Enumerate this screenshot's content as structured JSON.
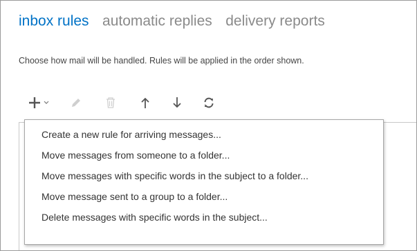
{
  "tabs": [
    {
      "label": "inbox rules",
      "active": true
    },
    {
      "label": "automatic replies",
      "active": false
    },
    {
      "label": "delivery reports",
      "active": false
    }
  ],
  "description": "Choose how mail will be handled. Rules will be applied in the order shown.",
  "toolbar": {
    "buttons": [
      {
        "icon": "plus-icon",
        "enabled": true
      },
      {
        "icon": "chevron-down-icon",
        "enabled": true
      },
      {
        "icon": "pencil-icon",
        "enabled": false
      },
      {
        "icon": "trash-icon",
        "enabled": false
      },
      {
        "icon": "arrow-up-icon",
        "enabled": true
      },
      {
        "icon": "arrow-down-icon",
        "enabled": true
      },
      {
        "icon": "refresh-icon",
        "enabled": true
      }
    ]
  },
  "menu": {
    "items": [
      {
        "label": "Create a new rule for arriving messages..."
      },
      {
        "label": "Move messages from someone to a folder..."
      },
      {
        "label": "Move messages with specific words in the subject to a folder..."
      },
      {
        "label": "Move message sent to a group to a folder..."
      },
      {
        "label": "Delete messages with specific words in the subject..."
      }
    ]
  },
  "colors": {
    "accent": "#0072c6",
    "inactive_tab": "#8a8a8a",
    "icon": "#555555",
    "icon_disabled": "#cfcfcf"
  }
}
